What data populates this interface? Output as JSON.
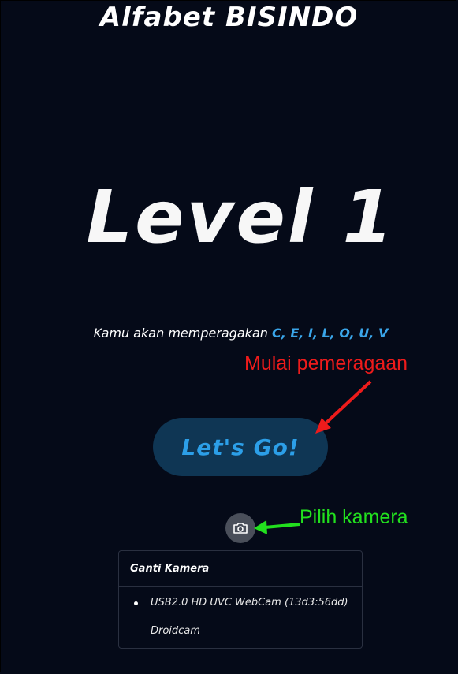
{
  "app": {
    "title": "Alfabet BISINDO"
  },
  "level": {
    "title": "Level 1",
    "description_prefix": "Kamu akan memperagakan",
    "letters": "C, E, I, L, O, U, V"
  },
  "start_button": {
    "label": "Let's Go!"
  },
  "annotations": {
    "start": "Mulai pemeragaan",
    "camera": "Pilih kamera"
  },
  "camera_panel": {
    "title": "Ganti Kamera",
    "options": [
      "USB2.0 HD UVC WebCam (13d3:56dd)",
      "Droidcam"
    ]
  },
  "colors": {
    "background": "#050a18",
    "accent": "#2c9fe8",
    "button_bg": "#0f3654",
    "annotation_red": "#ee1b1b",
    "annotation_green": "#22e01e"
  },
  "icons": {
    "camera": "camera-icon"
  }
}
